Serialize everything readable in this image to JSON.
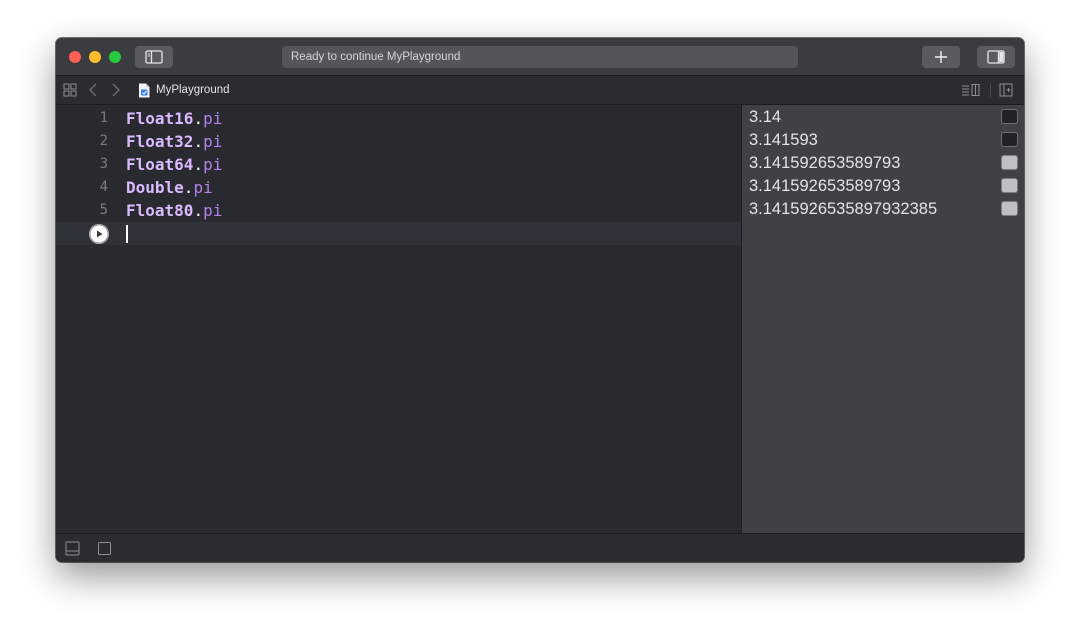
{
  "window": {
    "activity_status": "Ready to continue MyPlayground"
  },
  "jumpbar": {
    "file_title": "MyPlayground"
  },
  "editor": {
    "lines": [
      {
        "number": "1",
        "type": "Float16",
        "dot": ".",
        "member": "pi"
      },
      {
        "number": "2",
        "type": "Float32",
        "dot": ".",
        "member": "pi"
      },
      {
        "number": "3",
        "type": "Float64",
        "dot": ".",
        "member": "pi"
      },
      {
        "number": "4",
        "type": "Double",
        "dot": ".",
        "member": "pi"
      },
      {
        "number": "5",
        "type": "Float80",
        "dot": ".",
        "member": "pi"
      }
    ]
  },
  "results": {
    "rows": [
      {
        "value": "3.14",
        "quick_look_style": "dark"
      },
      {
        "value": "3.141593",
        "quick_look_style": "dark"
      },
      {
        "value": "3.141592653589793",
        "quick_look_style": "light"
      },
      {
        "value": "3.141592653589793",
        "quick_look_style": "light"
      },
      {
        "value": "3.1415926535897932385",
        "quick_look_style": "light"
      }
    ]
  },
  "colors": {
    "type_name": "#dabaff",
    "member_name": "#b281eb",
    "editor_background": "#292a30",
    "results_background": "#404145"
  },
  "icons": {
    "traffic_lights": [
      "close-icon",
      "minimize-icon",
      "zoom-icon"
    ],
    "toolbar": [
      "sidebar-toggle-icon",
      "plus-icon",
      "inspector-toggle-icon"
    ],
    "jumpbar": [
      "grid-icon",
      "chevron-left-icon",
      "chevron-right-icon",
      "playground-file-icon",
      "editor-options-icon",
      "canvas-toggle-icon"
    ],
    "debugbar": [
      "debug-area-icon",
      "stop-icon"
    ]
  }
}
